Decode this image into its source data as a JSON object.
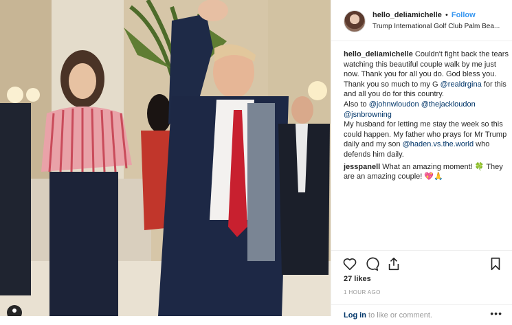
{
  "post": {
    "user": {
      "username": "hello_deliamichelle",
      "separator": "•",
      "follow_label": "Follow"
    },
    "location": "Trump International Golf Club Palm Bea...",
    "comments": [
      {
        "username": "hello_deliamichelle",
        "text_1": " Couldn't fight back the tears watching this beautiful couple walk by me just now. Thank you for all you do. God bless you.",
        "text_2": "Thank you so much to my G ",
        "mention_1": "@realdrgina",
        "text_3": " for this and all you do for this country.",
        "text_4": "Also to ",
        "mention_2": "@johnwloudon",
        "mention_3": "@thejackloudon",
        "mention_4": "@jsnbrowning",
        "text_5": "My husband for letting me stay the week so this could happen. My father who prays for Mr Trump daily and my son ",
        "mention_5": "@haden.vs.the.world",
        "text_6": " who defends him daily."
      },
      {
        "username": "jesspanell",
        "text": " What an amazing moment! 🍀 They are an amazing couple! 💖🙏"
      }
    ],
    "likes": "27 likes",
    "time": "1 HOUR AGO",
    "add_comment": {
      "login": "Log in",
      "rest": " to like or comment.",
      "more": "•••"
    },
    "icons": [
      "heart-icon",
      "comment-icon",
      "share-icon",
      "bookmark-icon"
    ]
  },
  "colors": {
    "link": "#3897f0",
    "mention": "#003569",
    "muted": "#999999"
  }
}
